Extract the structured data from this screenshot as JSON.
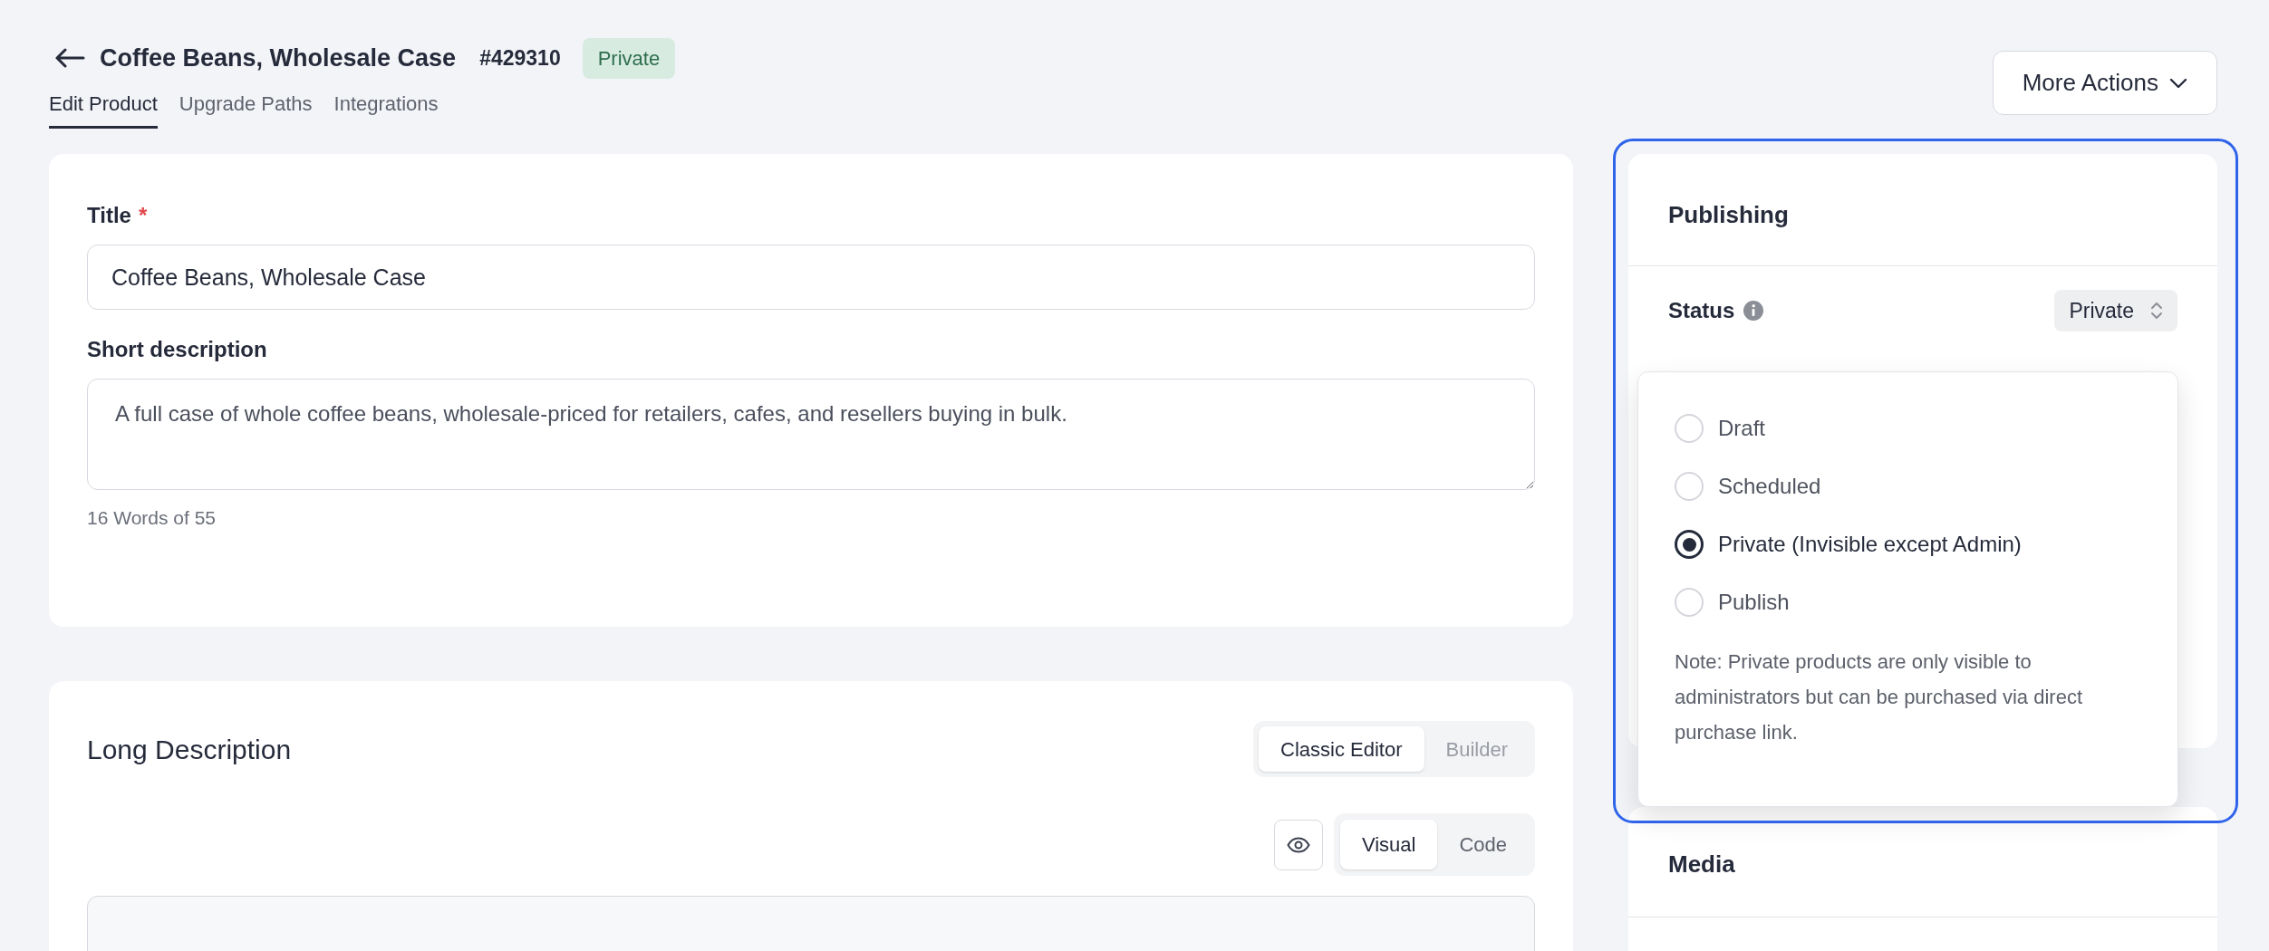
{
  "header": {
    "title": "Coffee Beans, Wholesale Case",
    "id": "#429310",
    "badge": "Private"
  },
  "tabs": [
    {
      "label": "Edit Product",
      "selected": true
    },
    {
      "label": "Upgrade Paths",
      "selected": false
    },
    {
      "label": "Integrations",
      "selected": false
    }
  ],
  "more_actions": {
    "label": "More Actions"
  },
  "product_form": {
    "title_label": "Title",
    "required_mark": "*",
    "title_value": "Coffee Beans, Wholesale Case",
    "short_description_label": "Short description",
    "short_description_value": "A full case of whole coffee beans, wholesale-priced for retailers, cafes, and resellers buying in bulk.",
    "word_count": "16 Words of 55"
  },
  "long_description": {
    "heading": "Long Description",
    "editor_modes": [
      {
        "label": "Classic Editor",
        "selected": true
      },
      {
        "label": "Builder",
        "selected": false
      }
    ],
    "view_modes": [
      {
        "label": "Visual",
        "selected": true
      },
      {
        "label": "Code",
        "selected": false
      }
    ]
  },
  "publishing": {
    "heading": "Publishing",
    "status_label": "Status",
    "status_value": "Private",
    "options": [
      {
        "label": "Draft",
        "selected": false
      },
      {
        "label": "Scheduled",
        "selected": false
      },
      {
        "label": "Private (Invisible except Admin)",
        "selected": true
      },
      {
        "label": "Publish",
        "selected": false
      }
    ],
    "note": "Note: Private products are only visible to administrators but can be purchased via direct purchase link."
  },
  "media": {
    "heading": "Media"
  }
}
